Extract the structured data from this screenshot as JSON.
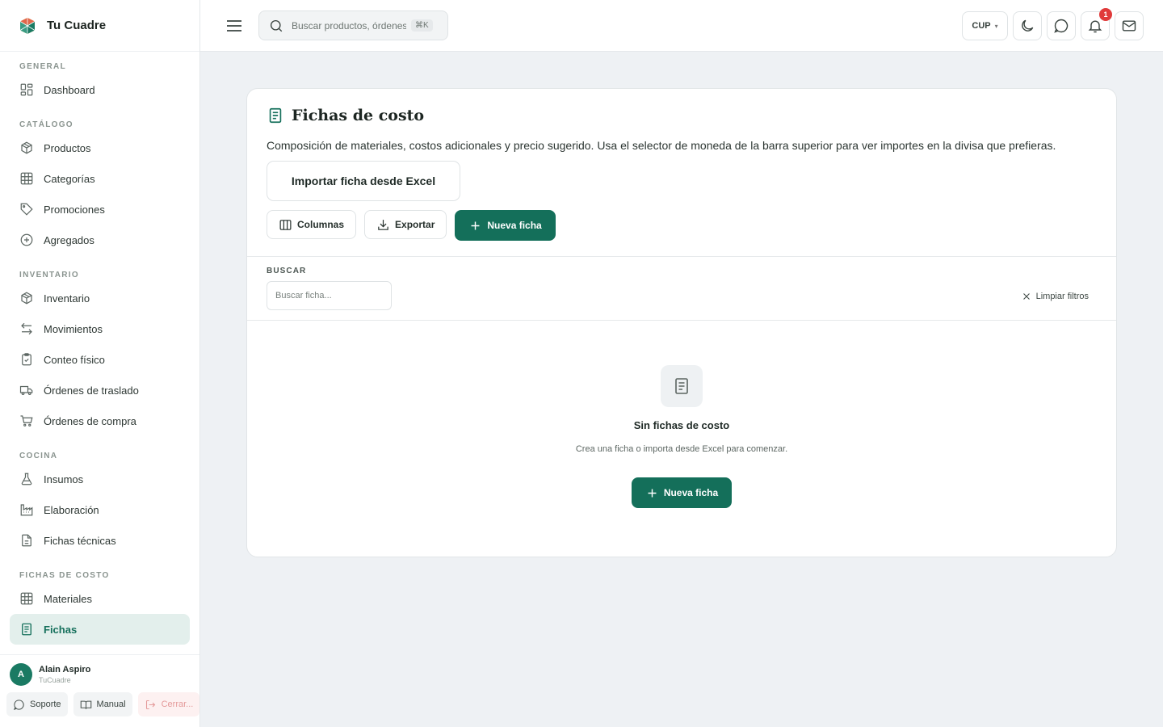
{
  "brand": {
    "name": "Tu Cuadre"
  },
  "sidebar": {
    "sections": [
      {
        "title": "GENERAL",
        "items": [
          {
            "label": "Dashboard",
            "icon": "dashboard-icon"
          }
        ]
      },
      {
        "title": "CATÁLOGO",
        "items": [
          {
            "label": "Productos",
            "icon": "box-icon"
          },
          {
            "label": "Categorías",
            "icon": "grid-icon"
          },
          {
            "label": "Promociones",
            "icon": "tag-icon"
          },
          {
            "label": "Agregados",
            "icon": "plus-circle-icon"
          }
        ]
      },
      {
        "title": "INVENTARIO",
        "items": [
          {
            "label": "Inventario",
            "icon": "box-icon"
          },
          {
            "label": "Movimientos",
            "icon": "arrows-icon"
          },
          {
            "label": "Conteo físico",
            "icon": "clipboard-check-icon"
          },
          {
            "label": "Órdenes de traslado",
            "icon": "truck-icon"
          },
          {
            "label": "Órdenes de compra",
            "icon": "cart-icon"
          }
        ]
      },
      {
        "title": "COCINA",
        "items": [
          {
            "label": "Insumos",
            "icon": "flask-icon"
          },
          {
            "label": "Elaboración",
            "icon": "factory-icon"
          },
          {
            "label": "Fichas técnicas",
            "icon": "file-text-icon"
          }
        ]
      },
      {
        "title": "FICHAS DE COSTO",
        "items": [
          {
            "label": "Materiales",
            "icon": "grid-icon"
          },
          {
            "label": "Fichas",
            "icon": "receipt-icon",
            "active": true
          }
        ]
      }
    ]
  },
  "user": {
    "initial": "A",
    "name": "Alain Aspiro",
    "org": "TuCuadre",
    "actions": {
      "support": "Soporte",
      "manual": "Manual",
      "logout": "Cerrar..."
    }
  },
  "topbar": {
    "search_placeholder": "Buscar productos, órdenes...",
    "shortcut": "⌘K",
    "currency": "CUP",
    "notifications_count": "1"
  },
  "page": {
    "title": "Fichas de costo",
    "description": "Composición de materiales, costos adicionales y precio sugerido. Usa el selector de moneda de la barra superior para ver importes en la divisa que prefieras.",
    "import_label": "Importar ficha desde Excel",
    "columns_label": "Columnas",
    "export_label": "Exportar",
    "new_label": "Nueva ficha",
    "filter_label": "BUSCAR",
    "filter_placeholder": "Buscar ficha...",
    "clear_label": "Limpiar filtros",
    "empty_title": "Sin fichas de costo",
    "empty_sub": "Crea una ficha o importa desde Excel para comenzar.",
    "empty_btn": "Nueva ficha"
  },
  "colors": {
    "accent": "#146f5a",
    "active_bg": "#e3efec",
    "badge": "#e03a3a"
  }
}
